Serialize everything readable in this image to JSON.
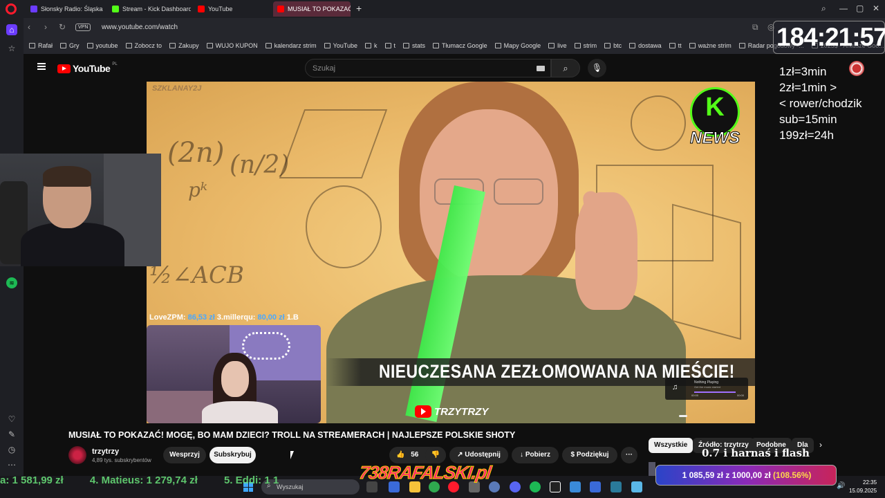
{
  "browser": {
    "tabs": [
      {
        "label": "Słonsky Radio: Śląska",
        "color": "#6b3cff"
      },
      {
        "label": "Stream - Kick Dashboard",
        "color": "#53fc18"
      },
      {
        "label": "YouTube",
        "color": "#ff0000"
      },
      {
        "label": "MUSIAŁ TO POKAZAĆ",
        "color": "#ff0000"
      }
    ],
    "vpn_label": "VPN",
    "url": "www.youtube.com/watch",
    "bookmarks": [
      "Rafał",
      "Gry",
      "youtube",
      "Zobocz to",
      "Zakupy",
      "WUJO KUPON",
      "kalendarz strim",
      "YouTube",
      "k",
      "t",
      "stats",
      "Tłumacz Google",
      "Mapy Google",
      "live",
      "strim",
      "btc",
      "dostawa",
      "tt",
      "ważne strim",
      "Radar pogodowy -...",
      "2025$ - Arkusze Goo..."
    ]
  },
  "youtube": {
    "logo_text": "YouTube",
    "region": "PL",
    "search_placeholder": "Szukaj"
  },
  "video": {
    "watermark": "SZKLANAY2J",
    "badge": "NEWS",
    "caption": "NIEUCZESANA ZEZŁOMOWANA NA MIEŚCIE!",
    "channel_watermark": "TRZYTRZY",
    "math_1": "(2n)",
    "math_2": "pᵏ",
    "math_3": "(n/2)",
    "math_4": "½∠ACB",
    "now_playing_title": "Nothing Playing",
    "now_playing_sub": "Get the music started",
    "np_time_start": "00:00",
    "np_time_end": "00:00"
  },
  "overlay": {
    "timer": "184:21:57",
    "rules": "1zł=3min\n2zł=1min >\n< rower/chodzik\nsub=15min\n199zł=24h",
    "tip_ticker_name1": "LoveZPM:",
    "tip_ticker_amt1": "86,53 zł",
    "tip_ticker_name2": "3.millerqu:",
    "tip_ticker_amt2": "80,00 zł",
    "tip_ticker_name3": "1.B",
    "leaders": [
      "a: 1 581,99 zł",
      "4. Matieus: 1 279,74 zł",
      "5. Eddi: 1 1"
    ],
    "brand": "738RAFALSKI.pl",
    "beer_text": "0.7 i harnaś i flash",
    "goal_current": "1 085,59 zł",
    "goal_sep": "z",
    "goal_target": "1000,00 zł",
    "goal_pct": "(108.56%)"
  },
  "watch": {
    "title": "MUSIAŁ TO POKAZAĆ! MOGĘ, BO MAM DZIECI? TROLL NA STREAMERACH | NAJLEPSZE POLSKIE SHOTY",
    "channel": "trzytrzy",
    "subscribers": "4,89 tys. subskrybentów",
    "support_label": "Wesprzyj",
    "subscribe_label": "Subskrybuj",
    "likes": "56",
    "share_label": "Udostępnij",
    "download_label": "Pobierz",
    "thanks_label": "Podziękuj",
    "more_label": "···"
  },
  "sidebar_filters": [
    "Wszystkie",
    "Źródło: trzytrzy",
    "Podobne",
    "Dla"
  ],
  "taskbar": {
    "search_placeholder": "Wyszukaj",
    "time": "22:35",
    "date": "15.09.2025"
  }
}
